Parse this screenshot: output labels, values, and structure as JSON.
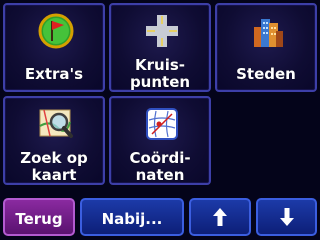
{
  "menu": {
    "tiles": [
      {
        "id": "extras",
        "label": "Extra's",
        "icon": "flag-icon"
      },
      {
        "id": "crossings",
        "label": "Kruis-\npunten",
        "icon": "intersection-icon"
      },
      {
        "id": "cities",
        "label": "Steden",
        "icon": "city-icon"
      },
      {
        "id": "map-search",
        "label": "Zoek op\nkaart",
        "icon": "map-magnifier-icon"
      },
      {
        "id": "coordinates",
        "label": "Coördi-\nnaten",
        "icon": "globe-coordinates-icon"
      }
    ]
  },
  "bottombar": {
    "back_label": "Terug",
    "near_label": "Nabij...",
    "up_icon": "arrow-up-icon",
    "down_icon": "arrow-down-icon"
  },
  "colors": {
    "background": "#04041a",
    "tile_border": "#3d3fa8",
    "back_button": "#7a2090",
    "blue_button": "#1a2f95"
  }
}
